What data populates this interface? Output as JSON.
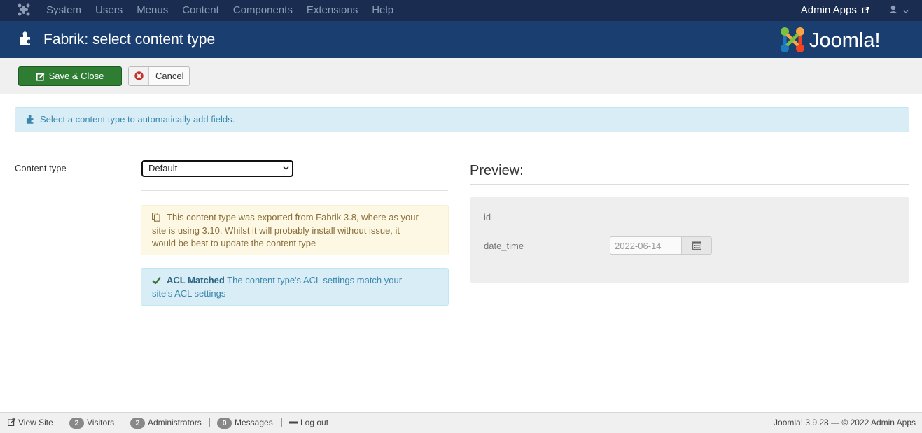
{
  "topnav": {
    "menu": [
      "System",
      "Users",
      "Menus",
      "Content",
      "Components",
      "Extensions",
      "Help"
    ],
    "admin_link": "Admin Apps"
  },
  "header": {
    "title": "Fabrik: select content type",
    "brand": "Joomla!"
  },
  "toolbar": {
    "save_close": "Save & Close",
    "cancel": "Cancel"
  },
  "info_message": "Select a content type to automatically add fields.",
  "form": {
    "content_type_label": "Content type",
    "content_type_value": "Default"
  },
  "warning": "This content type was exported from Fabrik 3.8, where as your site is using 3.10. Whilst it will probably install without issue, it would be best to update the content type",
  "acl": {
    "title": "ACL Matched",
    "text": " The content type's ACL settings match your site's ACL settings"
  },
  "preview": {
    "heading": "Preview:",
    "field_id": "id",
    "field_date": "date_time",
    "date_value": "2022-06-14"
  },
  "statusbar": {
    "view_site": "View Site",
    "visitors_count": "2",
    "visitors": "Visitors",
    "admins_count": "2",
    "admins": "Administrators",
    "messages_count": "0",
    "messages": "Messages",
    "logout": "Log out",
    "version": "Joomla! 3.9.28",
    "copyright": "— © 2022 Admin Apps"
  },
  "colors": {
    "topnav": "#1a2d50",
    "header": "#1b3e71",
    "save_button": "#2f7d32",
    "info_bg": "#d9edf7",
    "warning_bg": "#fcf8e3"
  }
}
